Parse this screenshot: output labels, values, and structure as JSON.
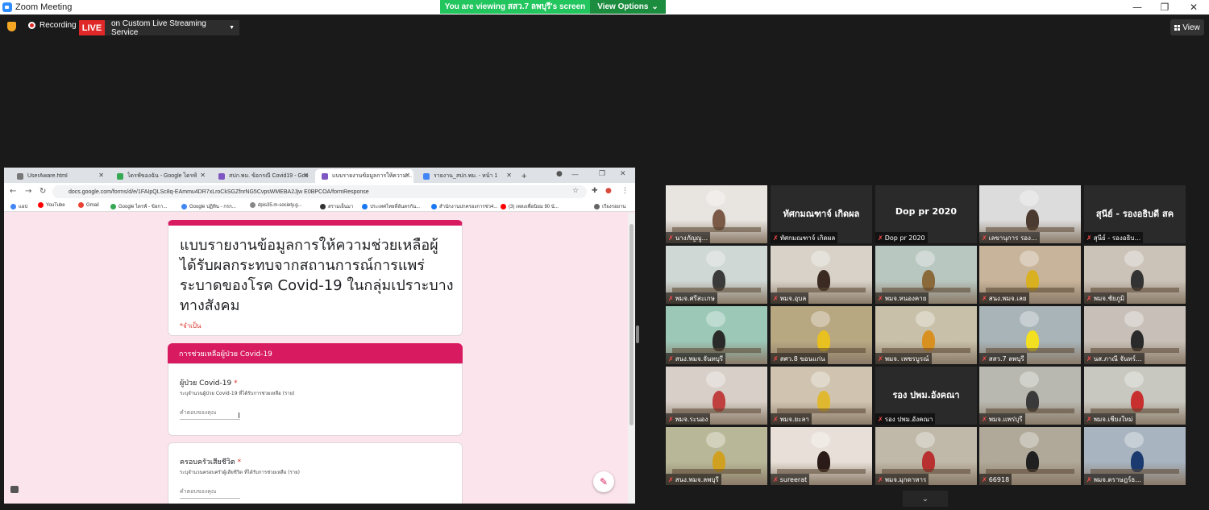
{
  "window": {
    "title": "Zoom Meeting",
    "viewing_banner": "You are viewing สสว.7 ลพบุรี's screen",
    "view_options": "View Options",
    "minimize": "—",
    "maximize": "❐",
    "close": "✕"
  },
  "toolbar": {
    "recording": "Recording",
    "live": "LIVE",
    "stream_service": "on Custom Live Streaming Service",
    "view_label": "View"
  },
  "browser": {
    "tabs": [
      {
        "title": "UserAware.html",
        "color": "#777777"
      },
      {
        "title": "ไดรฟ์ของฉัน - Google ไดรฟ์",
        "color": "#34a853"
      },
      {
        "title": "สปก.พม. ข้อกรณี Covid19 - Goo",
        "color": "#7e57c2"
      },
      {
        "title": "แบบรายงานข้อมูลการให้ความช่วยเห",
        "color": "#7e57c2"
      },
      {
        "title": "รายงาน_สปก.พม. - หน้า 1",
        "color": "#4285f4"
      }
    ],
    "new_tab": "+",
    "url": "docs.google.com/forms/d/e/1FAIpQLSc8q-EAmmu4DR7xLroCkSGZfnrNG5CvpsWMEBA2Jjw E0BPCOA/formResponse",
    "bookmarks": [
      {
        "label": "แอป",
        "color": "#4285f4"
      },
      {
        "label": "YouTube",
        "color": "#ff0000"
      },
      {
        "label": "Gmail",
        "color": "#ea4335"
      },
      {
        "label": "Google ไดรฟ์ - ข้อกา...",
        "color": "#34a853"
      },
      {
        "label": "Google ปฏิทิน - กรก...",
        "color": "#4285f4"
      },
      {
        "label": "dpis35.m-society.g...",
        "color": "#888888"
      },
      {
        "label": "สรามเย็นมา",
        "color": "#333333"
      },
      {
        "label": "ประเทศไทยที่อันตรกัน...",
        "color": "#1877f2"
      },
      {
        "label": "สำนักงานปกครองการช่ว4...",
        "color": "#1877f2"
      },
      {
        "label": "(3) เพลงเพื่อนิยม 90 นั...",
        "color": "#ff0000"
      },
      {
        "label": "เรียงรอยาน",
        "color": "#666666"
      }
    ]
  },
  "form": {
    "title": "แบบรายงานข้อมูลการให้ความช่วยเหลือผู้ได้รับผลกระทบจากสถานการณ์การแพร่ระบาดของโรค Covid-19 ในกลุ่มเปราะบางทางสังคม",
    "required_note": "*จำเป็น",
    "section": "การช่วยเหลือผู้ป่วย Covid-19",
    "questions": [
      {
        "label": "ผู้ป่วย Covid-19",
        "star": "*",
        "desc": "ระบุจำนวนผู้ป่วย Covid-19 ที่ได้รับการช่วยเหลือ (ราย)",
        "placeholder": "คำตอบของคุณ"
      },
      {
        "label": "ครอบครัวเสียชีวิต",
        "star": "*",
        "desc": "ระบุจำนวนครอบครัวผู้เสียชีวิต ที่ได้รับการช่วยเหลือ (ราย)",
        "placeholder": "คำตอบของคุณ"
      }
    ]
  },
  "participants": [
    {
      "name": "นางภัญญู...",
      "big": "",
      "bg": "#e8e4e0",
      "face": "#7a5a46"
    },
    {
      "name": "ทัศกมณฑาจ์ เกิดผล",
      "big": "ทัศกมณฑาจ์ เกิดผล",
      "bg": "#2a2a2a",
      "face": ""
    },
    {
      "name": "Dop pr 2020",
      "big": "Dop pr 2020",
      "bg": "#2a2a2a",
      "face": ""
    },
    {
      "name": "เลขานุการ รอง...",
      "big": "",
      "bg": "#dcdcdc",
      "face": "#4a3a30"
    },
    {
      "name": "สุนีย์ - รองอธิบ...",
      "big": "สุนีย์ - รองอธิบดี สค",
      "bg": "#2a2a2a",
      "face": ""
    },
    {
      "name": "พมจ.ศรีสะเกษ",
      "big": "",
      "bg": "#cfd8d4",
      "face": "#3a3a3a"
    },
    {
      "name": "พมจ.อุบล",
      "big": "",
      "bg": "#d8d2c8",
      "face": "#3a2a22"
    },
    {
      "name": "พมจ.หนองคาย",
      "big": "",
      "bg": "#b9c7c1",
      "face": "#8a6a3a"
    },
    {
      "name": "สนง.พมจ.เลย",
      "big": "",
      "bg": "#c8b49a",
      "face": "#d8b020"
    },
    {
      "name": "พมจ.ชัยภูมิ",
      "big": "",
      "bg": "#cbc3b8",
      "face": "#333333"
    },
    {
      "name": "สนง.พมจ.จันทบุรี",
      "big": "",
      "bg": "#9cc8b8",
      "face": "#2a2a2a"
    },
    {
      "name": "สศว.8 ขอนแก่น",
      "big": "",
      "bg": "#b8a882",
      "face": "#e8c020"
    },
    {
      "name": "พมจ. เพชรบูรณ์",
      "big": "",
      "bg": "#c8c0a8",
      "face": "#d89020"
    },
    {
      "name": "สสว.7 ลพบุรี",
      "big": "",
      "bg": "#a8b4b8",
      "face": "#f3e020"
    },
    {
      "name": "นส.ภาณี จันทร์...",
      "big": "",
      "bg": "#c8c0b8",
      "face": "#2a2a2a"
    },
    {
      "name": "พมจ.ระนอง",
      "big": "",
      "bg": "#d8d0c8",
      "face": "#c04040"
    },
    {
      "name": "พมจ.ยะลา",
      "big": "",
      "bg": "#d0c4b0",
      "face": "#e0b830"
    },
    {
      "name": "รอง ปพม.อังคณา",
      "big": "รอง ปพม.อังคณา",
      "bg": "#2a2a2a",
      "face": ""
    },
    {
      "name": "พมจ.แพร่บุรี",
      "big": "",
      "bg": "#b8b8b0",
      "face": "#3a3a3a"
    },
    {
      "name": "พมจ.เชียงใหม่",
      "big": "",
      "bg": "#c8c8c0",
      "face": "#c83030"
    },
    {
      "name": "สนง.พมจ.ลพบุรี",
      "big": "",
      "bg": "#b8b898",
      "face": "#d0a020"
    },
    {
      "name": "sureerat",
      "big": "",
      "bg": "#e8e0d8",
      "face": "#2a1a18"
    },
    {
      "name": "พมจ.มุกดาหาร",
      "big": "",
      "bg": "#c0b8a8",
      "face": "#b83030"
    },
    {
      "name": "66918",
      "big": "",
      "bg": "#b0a898",
      "face": "#202020"
    },
    {
      "name": "พมจ.ตราษฎร์ธ...",
      "big": "",
      "bg": "#a8b4c0",
      "face": "#1a3a70"
    }
  ]
}
